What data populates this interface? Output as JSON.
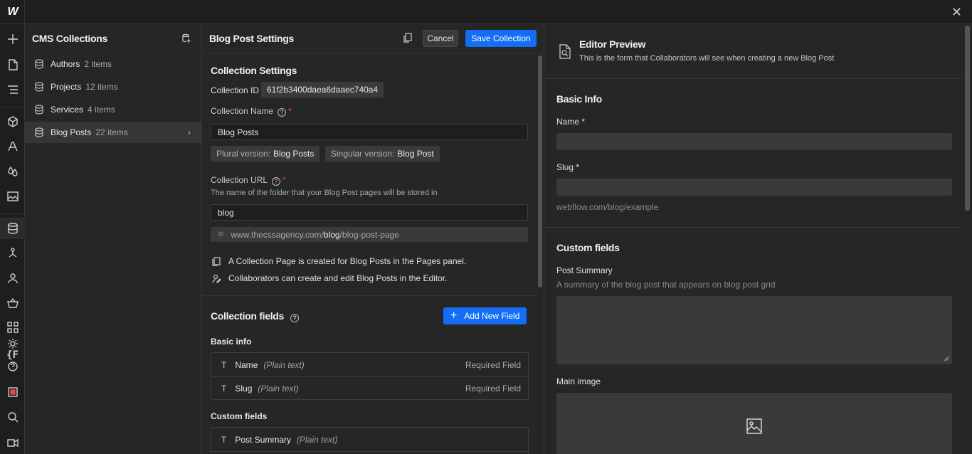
{
  "app": {
    "logo": "W",
    "close_label": "✕"
  },
  "collections_panel": {
    "title": "CMS Collections",
    "items": [
      {
        "name": "Authors",
        "count": "2 items"
      },
      {
        "name": "Projects",
        "count": "12 items"
      },
      {
        "name": "Services",
        "count": "4 items"
      },
      {
        "name": "Blog Posts",
        "count": "22 items"
      }
    ],
    "active_index": 3
  },
  "settings_panel": {
    "title": "Blog Post Settings",
    "cancel_label": "Cancel",
    "save_label": "Save Collection",
    "collection_settings": {
      "title": "Collection Settings",
      "id_label": "Collection ID",
      "id_value": "61f2b3400daea6daaec740a4",
      "name_label": "Collection Name",
      "name_value": "Blog Posts",
      "plural_label": "Plural version:",
      "plural_value": "Blog Posts",
      "singular_label": "Singular version:",
      "singular_value": "Blog Post",
      "url_label": "Collection URL",
      "url_help": "The name of the folder that your Blog Post pages will be stored in",
      "url_value": "blog",
      "url_preview_prefix": "www.thecssagency.com/",
      "url_preview_bold": "blog",
      "url_preview_suffix": "/blog-post-page",
      "info_page": "A Collection Page is created for Blog Posts in the Pages panel.",
      "info_editor": "Collaborators can create and edit Blog Posts in the Editor."
    },
    "collection_fields": {
      "title": "Collection fields",
      "add_label": "Add New Field",
      "basic_title": "Basic info",
      "basic_fields": [
        {
          "name": "Name",
          "type": "(Plain text)",
          "badge": "Required Field"
        },
        {
          "name": "Slug",
          "type": "(Plain text)",
          "badge": "Required Field"
        }
      ],
      "custom_title": "Custom fields",
      "custom_fields": [
        {
          "name": "Post Summary",
          "type": "(Plain text)"
        }
      ]
    }
  },
  "preview_panel": {
    "title": "Editor Preview",
    "subtitle": "This is the form that Collaborators will see when creating a new Blog Post",
    "basic_title": "Basic Info",
    "name_label": "Name *",
    "slug_label": "Slug *",
    "slug_hint": "webflow.com/blog/example",
    "custom_title": "Custom fields",
    "summary_label": "Post Summary",
    "summary_help": "A summary of the blog post that appears on blog post grid",
    "image_label": "Main image"
  },
  "colors": {
    "accent": "#146ef5",
    "required": "#e5484d",
    "panel_bg": "#262626",
    "app_bg": "#1e1e1e"
  }
}
